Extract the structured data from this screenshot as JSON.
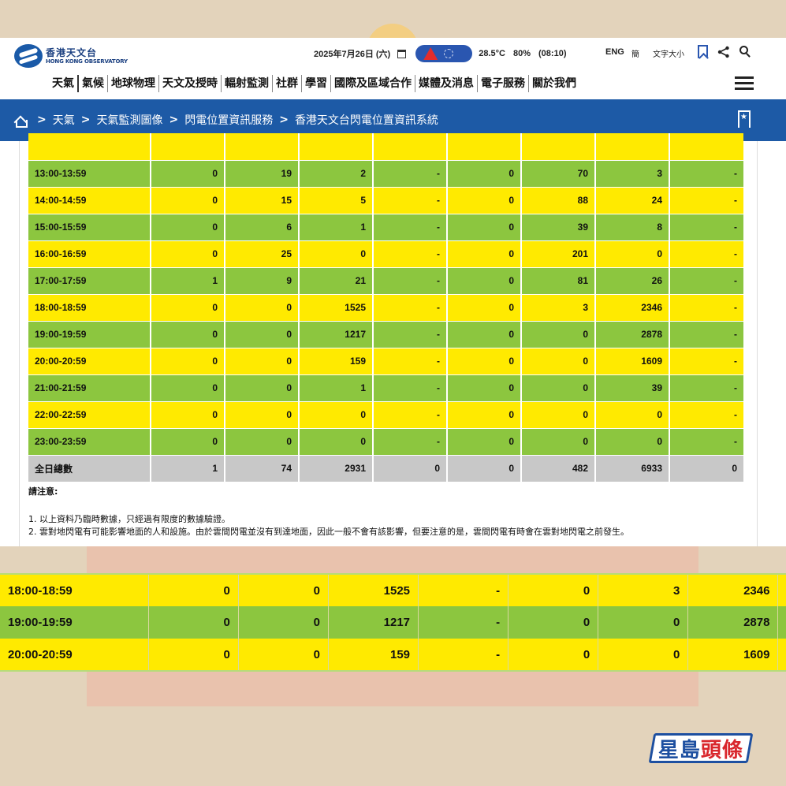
{
  "header": {
    "logo_zh": "香港天文台",
    "logo_en": "HONG KONG OBSERVATORY",
    "date": "2025年7月26日 (六)",
    "temperature": "28.5°C",
    "humidity": "80%",
    "obs_time": "(08:10)",
    "lang_eng": "ENG",
    "lang_simp": "簡",
    "font_size": "文字大小"
  },
  "nav": {
    "items": [
      "天氣",
      "氣候",
      "地球物理",
      "天文及授時",
      "輻射監測",
      "社群",
      "學習",
      "國際及區域合作",
      "媒體及消息",
      "電子服務",
      "關於我們"
    ]
  },
  "breadcrumb": {
    "sep": ">",
    "items": [
      "天氣",
      "天氣監測圖像",
      "閃電位置資訊服務",
      "香港天文台閃電位置資訊系統"
    ]
  },
  "table": {
    "rows": [
      {
        "time": "13:00-13:59",
        "v": [
          "0",
          "19",
          "2",
          "-",
          "0",
          "70",
          "3",
          "-"
        ],
        "color": "g"
      },
      {
        "time": "14:00-14:59",
        "v": [
          "0",
          "15",
          "5",
          "-",
          "0",
          "88",
          "24",
          "-"
        ],
        "color": "y"
      },
      {
        "time": "15:00-15:59",
        "v": [
          "0",
          "6",
          "1",
          "-",
          "0",
          "39",
          "8",
          "-"
        ],
        "color": "g"
      },
      {
        "time": "16:00-16:59",
        "v": [
          "0",
          "25",
          "0",
          "-",
          "0",
          "201",
          "0",
          "-"
        ],
        "color": "y"
      },
      {
        "time": "17:00-17:59",
        "v": [
          "1",
          "9",
          "21",
          "-",
          "0",
          "81",
          "26",
          "-"
        ],
        "color": "g"
      },
      {
        "time": "18:00-18:59",
        "v": [
          "0",
          "0",
          "1525",
          "-",
          "0",
          "3",
          "2346",
          "-"
        ],
        "color": "y"
      },
      {
        "time": "19:00-19:59",
        "v": [
          "0",
          "0",
          "1217",
          "-",
          "0",
          "0",
          "2878",
          "-"
        ],
        "color": "g"
      },
      {
        "time": "20:00-20:59",
        "v": [
          "0",
          "0",
          "159",
          "-",
          "0",
          "0",
          "1609",
          "-"
        ],
        "color": "y"
      },
      {
        "time": "21:00-21:59",
        "v": [
          "0",
          "0",
          "1",
          "-",
          "0",
          "0",
          "39",
          "-"
        ],
        "color": "g"
      },
      {
        "time": "22:00-22:59",
        "v": [
          "0",
          "0",
          "0",
          "-",
          "0",
          "0",
          "0",
          "-"
        ],
        "color": "y"
      },
      {
        "time": "23:00-23:59",
        "v": [
          "0",
          "0",
          "0",
          "-",
          "0",
          "0",
          "0",
          "-"
        ],
        "color": "g"
      }
    ],
    "total": {
      "label": "全日總數",
      "v": [
        "1",
        "74",
        "2931",
        "0",
        "0",
        "482",
        "6933",
        "0"
      ]
    }
  },
  "notes": {
    "title": "請注意:",
    "items": [
      "1. 以上資料乃臨時數據，只經過有限度的數據驗證。",
      "2. 雲對地閃電有可能影響地面的人和設施。由於雲間閃電並沒有到達地面，因此一般不會有該影響，但要注意的是，雲間閃電有時會在雲對地閃電之前發生。"
    ]
  },
  "zoom_rows": [
    {
      "time": "18:00-18:59",
      "v": [
        "0",
        "0",
        "1525",
        "-",
        "0",
        "3",
        "2346"
      ],
      "color": "y"
    },
    {
      "time": "19:00-19:59",
      "v": [
        "0",
        "0",
        "1217",
        "-",
        "0",
        "0",
        "2878"
      ],
      "color": "g"
    },
    {
      "time": "20:00-20:59",
      "v": [
        "0",
        "0",
        "159",
        "-",
        "0",
        "0",
        "1609"
      ],
      "color": "y"
    }
  ],
  "brand": {
    "part1": "星島",
    "part2": "頭條"
  },
  "colors": {
    "yellow": "#ffea00",
    "green": "#8cc63f",
    "total": "#c8c8c8",
    "blue": "#1d5aa6"
  }
}
